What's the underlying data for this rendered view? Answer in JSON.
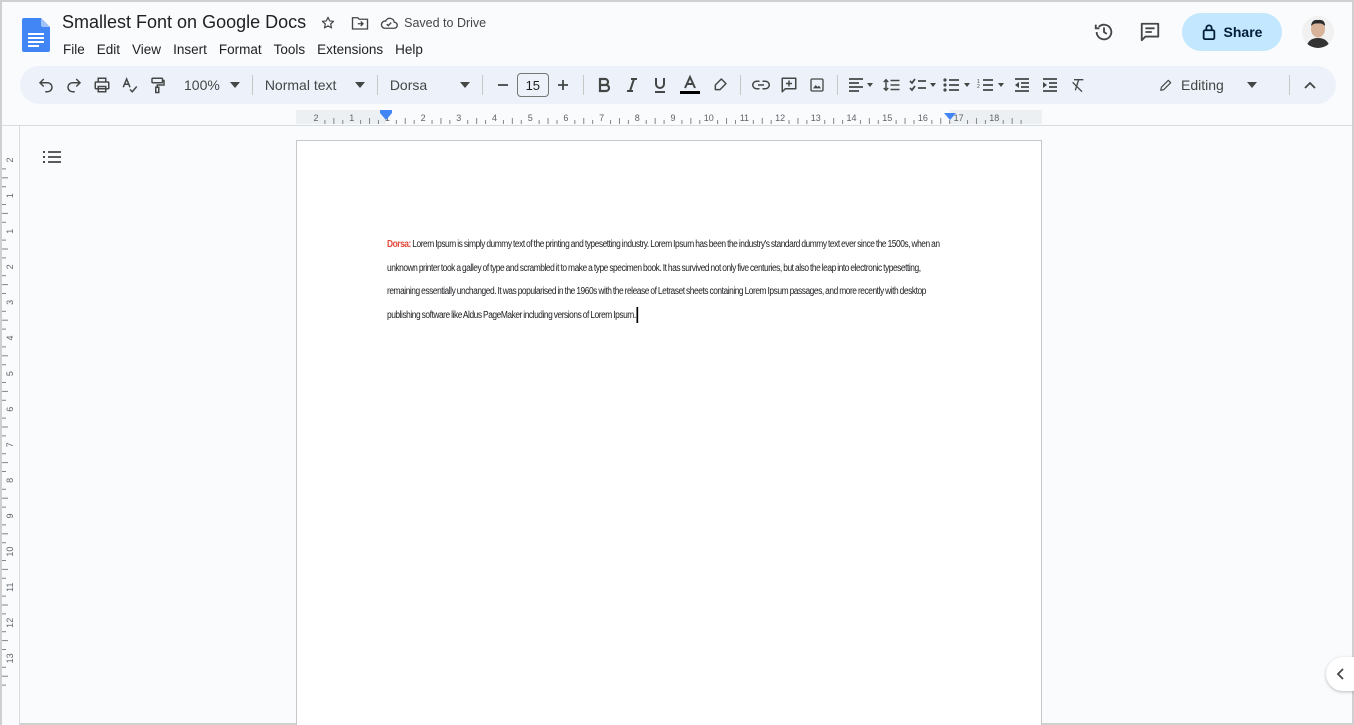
{
  "doc": {
    "title": "Smallest Font on Google Docs",
    "save_status": "Saved to Drive"
  },
  "menu": [
    "File",
    "Edit",
    "View",
    "Insert",
    "Format",
    "Tools",
    "Extensions",
    "Help"
  ],
  "share": {
    "label": "Share"
  },
  "toolbar": {
    "zoom": "100%",
    "style": "Normal text",
    "font": "Dorsa",
    "size": "15",
    "mode": "Editing"
  },
  "ruler": {
    "h_ticks": [
      "2",
      "1",
      "1",
      "2",
      "3",
      "4",
      "5",
      "6",
      "7",
      "8",
      "9",
      "10",
      "11",
      "12",
      "13",
      "14",
      "15",
      "16",
      "17",
      "18"
    ],
    "v_ticks": [
      "2",
      "1",
      "1",
      "2",
      "3",
      "4",
      "5",
      "6",
      "7",
      "8",
      "9",
      "10",
      "11",
      "12",
      "13"
    ]
  },
  "content": {
    "label": "Dorsa:",
    "body": " Lorem Ipsum is simply dummy text of the printing and typesetting industry. Lorem Ipsum has been the industry's standard dummy text ever since the 1500s, when an unknown printer took a galley of type and scrambled it to make a type specimen book. It has survived not only five centuries, but also the leap into electronic typesetting, remaining essentially unchanged. It was popularised in the 1960s with the release of Letraset sheets containing Lorem Ipsum passages, and more recently with desktop publishing software like Aldus PageMaker including versions of Lorem Ipsum."
  },
  "colors": {
    "accent": "#c2e7ff",
    "toolbar_bg": "#edf2fa",
    "label_red": "#e34b3c",
    "doc_blue": "#4285f4"
  },
  "icons": [
    "docs-logo-icon",
    "star-icon",
    "move-folder-icon",
    "cloud-saved-icon",
    "history-icon",
    "comment-icon",
    "lock-icon",
    "undo-icon",
    "redo-icon",
    "print-icon",
    "spellcheck-icon",
    "paint-format-icon",
    "bold-icon",
    "italic-icon",
    "underline-icon",
    "text-color-icon",
    "highlight-icon",
    "link-icon",
    "add-comment-icon",
    "image-icon",
    "align-left-icon",
    "line-spacing-icon",
    "checklist-icon",
    "bulleted-list-icon",
    "numbered-list-icon",
    "decrease-indent-icon",
    "increase-indent-icon",
    "clear-formatting-icon",
    "pencil-icon",
    "chevron-up-icon",
    "outline-icon",
    "chevron-left-icon"
  ]
}
